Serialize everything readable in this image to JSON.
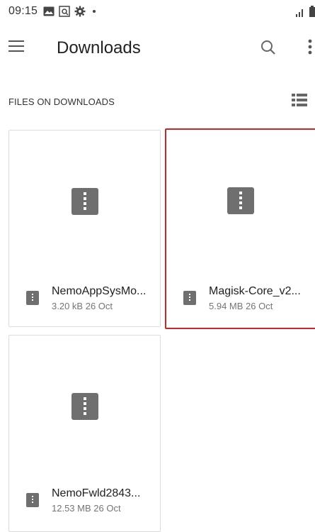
{
  "status_bar": {
    "time": "09:15",
    "icons": [
      "image-icon",
      "screenshot-icon",
      "settings-icon",
      "dot-icon"
    ],
    "right_icons": [
      "signal-icon",
      "battery-icon"
    ]
  },
  "app_bar": {
    "title": "Downloads",
    "menu_icon": "hamburger-menu-icon",
    "search_icon": "search-icon",
    "more_icon": "more-vert-icon"
  },
  "section": {
    "label": "FILES ON DOWNLOADS",
    "view_toggle_icon": "list-view-icon"
  },
  "files": [
    {
      "name": "NemoAppSysMo...",
      "size": "3.20 kB",
      "date": "26 Oct",
      "selected": false,
      "icon": "zip-file-icon"
    },
    {
      "name": "Magisk-Core_v2...",
      "size": "5.94 MB",
      "date": "26 Oct",
      "selected": true,
      "icon": "zip-file-icon"
    },
    {
      "name": "NemoFwld2843...",
      "size": "12.53 MB",
      "date": "26 Oct",
      "selected": false,
      "icon": "zip-file-icon"
    }
  ],
  "colors": {
    "selection_border": "#c62828",
    "file_icon": "#6f6f6f",
    "tile_border": "#dcdcdc"
  }
}
